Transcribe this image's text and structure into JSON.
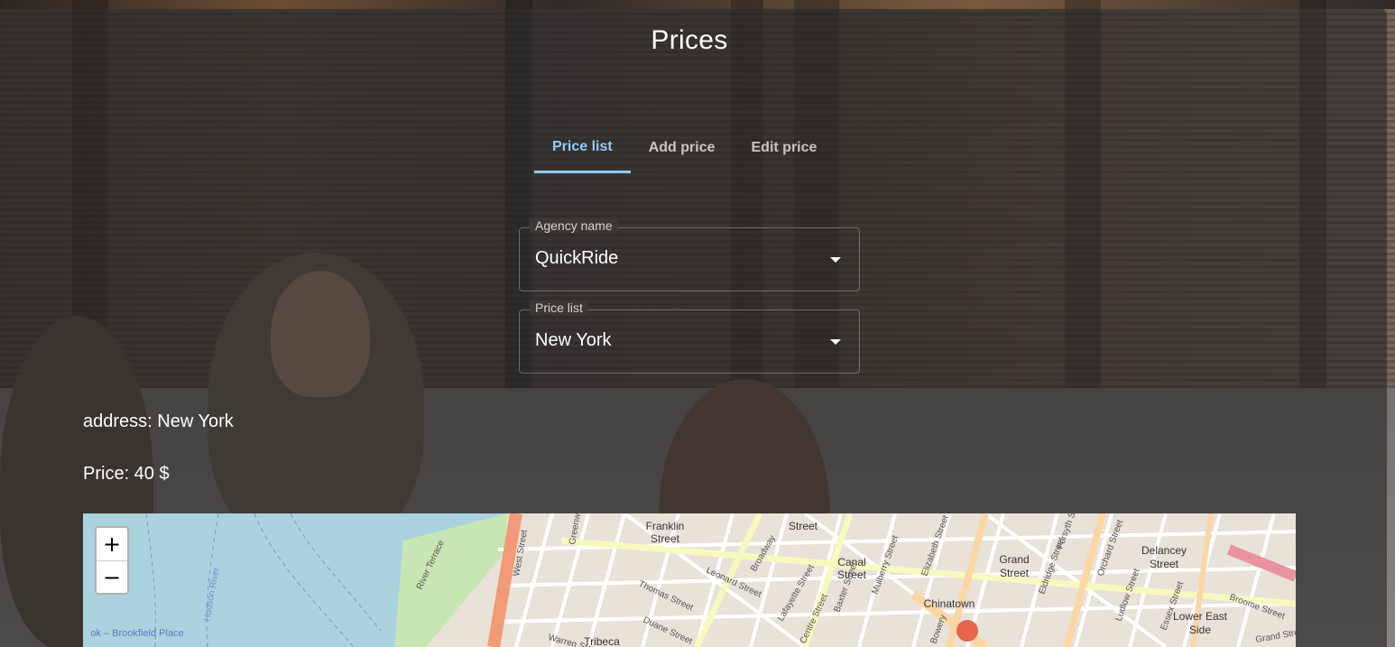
{
  "page": {
    "title": "Prices"
  },
  "tabs": [
    {
      "label": "Price list",
      "active": true
    },
    {
      "label": "Add price",
      "active": false
    },
    {
      "label": "Edit price",
      "active": false
    }
  ],
  "form": {
    "agency": {
      "label": "Agency name",
      "value": "QuickRide"
    },
    "price_list": {
      "label": "Price list",
      "value": "New York"
    }
  },
  "details": {
    "address": "address: New York",
    "price": "Price: 40 $"
  },
  "map": {
    "zoom_in": "+",
    "zoom_out": "−",
    "labels": {
      "franklin": [
        "Franklin",
        "Street"
      ],
      "canal1": [
        "Canal",
        "Street"
      ],
      "canal2": [
        "Canal",
        "Street"
      ],
      "grand": [
        "Grand",
        "Street"
      ],
      "delancey": [
        "Delancey",
        "Street"
      ],
      "chinatown": "Chinatown",
      "lower_east": [
        "Lower East",
        "Side"
      ],
      "tribeca": "Tribeca",
      "west_street": "West Street",
      "broadway": "Broadway",
      "lafayette": "Lafayette Street",
      "centre": "Centre Street",
      "hudson": "Hudson River",
      "brookfield": "ok – Brookfield Place",
      "bowery": "Bowery",
      "warren": "Warren Street",
      "duane": "Duane Street",
      "thomas": "Thomas Street",
      "leonard": "Leonard Street",
      "river_terrace": "River Terrace",
      "greenwich": "Greenwich",
      "baxter": "Baxter Street",
      "mulberry": "Mulberry Street",
      "elizabeth": "Elizabeth Street",
      "eldridge": "Eldridge Street",
      "forsyth": "Forsyth Street",
      "orchard": "Orchard Street",
      "ludlow": "Ludlow Street",
      "essex": "Essex Street",
      "broome": "Broome Street",
      "grand_st": "Grand Street"
    }
  }
}
